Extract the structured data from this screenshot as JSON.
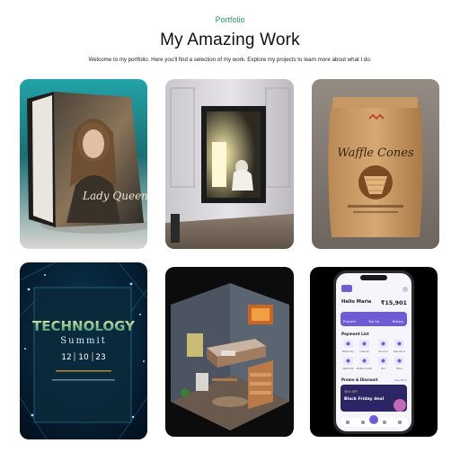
{
  "header": {
    "eyebrow": "Portfolio",
    "title": "My Amazing Work",
    "subtitle": "Welcome to my portfolio. Here you'll find a selection of my work. Explore my projects to learn more about what I do."
  },
  "works": [
    {
      "name": "book-cover",
      "cover_script": "Lady Queen"
    },
    {
      "name": "framed-room-art"
    },
    {
      "name": "waffle-cones-pouch",
      "product": "Waffle Cones"
    },
    {
      "name": "technology-summit-poster",
      "headline": "TECHNOLOGY",
      "subhead": "Summit",
      "date_parts": [
        "12",
        "10",
        "23"
      ]
    },
    {
      "name": "isometric-room"
    },
    {
      "name": "finance-app-mockup",
      "greeting": "Hello Maria",
      "balance": "₹15,901",
      "quick_actions": [
        "Transfer",
        "Top Up",
        "History"
      ],
      "payment_list_title": "Payment List",
      "payment_items": [
        "Electricity",
        "Internet",
        "Voucher",
        "Assurance",
        "Merchant",
        "Mobile Credit",
        "Bill",
        "More"
      ],
      "promo_title": "Promo & Discount",
      "promo_link": "See More",
      "promo_badge": "30% OFF",
      "promo_text": "Black Friday deal"
    }
  ],
  "colors": {
    "accent": "#2b9a64",
    "app_purple": "#6f5bd6"
  }
}
